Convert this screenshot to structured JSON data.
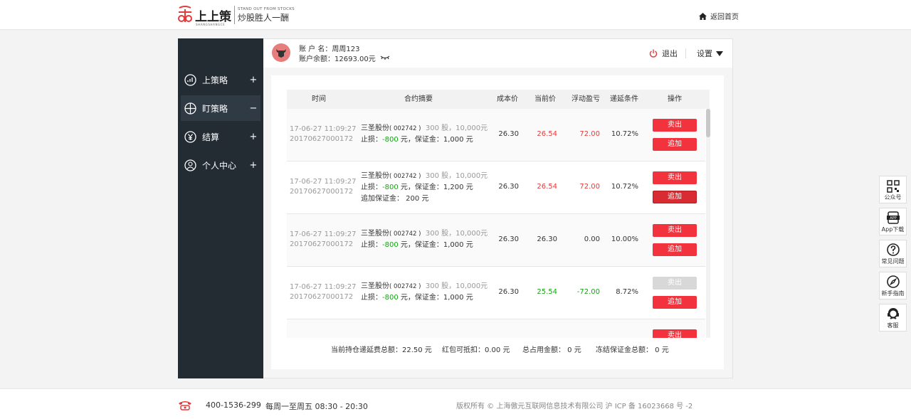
{
  "brand": {
    "name": "上上策",
    "pinyin": "SHANGSHANGCE",
    "slogan_en": "STAND OUT FROM STOCKS",
    "slogan_cn": "炒股胜人一酬",
    "colors": {
      "brand_red": "#e63a3a",
      "sidebar_bg": "#232b33"
    }
  },
  "header": {
    "home_link": "返回首页",
    "home_icon": "home-icon"
  },
  "sidebar": {
    "items": [
      {
        "label": "上策略",
        "sign": "+",
        "icon": "chart-icon"
      },
      {
        "label": "盯策略",
        "sign": "−",
        "icon": "crosshair-icon"
      },
      {
        "label": "结算",
        "sign": "+",
        "icon": "yen-icon"
      },
      {
        "label": "个人中心",
        "sign": "+",
        "icon": "user-icon"
      }
    ]
  },
  "account": {
    "name_label": "账 户 名：周周123",
    "balance_label": "账户余额：12693.00元",
    "logout": "退出",
    "settings": "设置"
  },
  "table": {
    "headers": [
      "时间",
      "合约摘要",
      "成本价",
      "当前价",
      "浮动盈亏",
      "递延条件",
      "操作"
    ],
    "rows": [
      {
        "time": "17-06-27 11:09:27",
        "id": "20170627000172",
        "stock": "三圣股份",
        "code": "( 002742 )",
        "shares": "300 股，10,000元",
        "stop_prefix": "止损：",
        "stop": "-800",
        "stop_mid": " 元，保证金：",
        "margin": "1,000 元",
        "extra": "",
        "cost": "26.30",
        "current": "26.54",
        "pnl": "72.00",
        "deferral": "10.72%",
        "sell": "卖出",
        "add": "追加"
      },
      {
        "time": "17-06-27 11:09:27",
        "id": "20170627000172",
        "stock": "三圣股份",
        "code": "( 002742 )",
        "shares": "300 股，10,000元",
        "stop_prefix": "止损：",
        "stop": "-800",
        "stop_mid": " 元，保证金：",
        "margin": "1,200 元",
        "extra": "追加保证金： 200 元",
        "cost": "26.30",
        "current": "26.54",
        "pnl": "72.00",
        "deferral": "10.72%",
        "sell": "卖出",
        "add": "追加"
      },
      {
        "time": "17-06-27 11:09:27",
        "id": "20170627000172",
        "stock": "三圣股份",
        "code": "( 002742 )",
        "shares": "300 股，10,000元",
        "stop_prefix": "止损：",
        "stop": "-800",
        "stop_mid": " 元，保证金：",
        "margin": "1,000 元",
        "extra": "",
        "cost": "26.30",
        "current": "26.30",
        "pnl": "0.00",
        "deferral": "10.00%",
        "sell": "卖出",
        "add": "追加"
      },
      {
        "time": "17-06-27 11:09:27",
        "id": "20170627000172",
        "stock": "三圣股份",
        "code": "( 002742 )",
        "shares": "300 股，10,000元",
        "stop_prefix": "止损：",
        "stop": "-800",
        "stop_mid": " 元，保证金：",
        "margin": "1,000 元",
        "extra": "",
        "cost": "26.30",
        "current": "25.54",
        "pnl": "-72.00",
        "deferral": "8.72%",
        "sell": "卖出",
        "add": "追加"
      },
      {
        "time": "",
        "id": "",
        "stock": "",
        "code": "",
        "shares": "",
        "stop_prefix": "",
        "stop": "",
        "stop_mid": "",
        "margin": "",
        "extra": "",
        "cost": "",
        "current": "",
        "pnl": "",
        "deferral": "",
        "sell": "卖出",
        "add": ""
      }
    ]
  },
  "totals": {
    "deferral_fee": "当前持仓递延费总额：22.50 元",
    "red_packet": "红包可抵扣：0.00 元",
    "total_funds": "总占用金额： 0 元",
    "frozen_margin": "冻结保证金总额： 0 元"
  },
  "tools": [
    {
      "label": "公众号",
      "icon": "qrcode-icon"
    },
    {
      "label": "App下载",
      "icon": "app-icon"
    },
    {
      "label": "常见问题",
      "icon": "question-icon"
    },
    {
      "label": "新手指南",
      "icon": "compass-icon"
    },
    {
      "label": "客服",
      "icon": "headset-icon"
    }
  ],
  "footer": {
    "phone": "400-1536-299",
    "hours": "每周一至周五 08:30 - 20:30",
    "copyright": "版权所有 © 上海傲元互联网信息技术有限公司 沪 ICP 备 16023668 号 -2"
  }
}
